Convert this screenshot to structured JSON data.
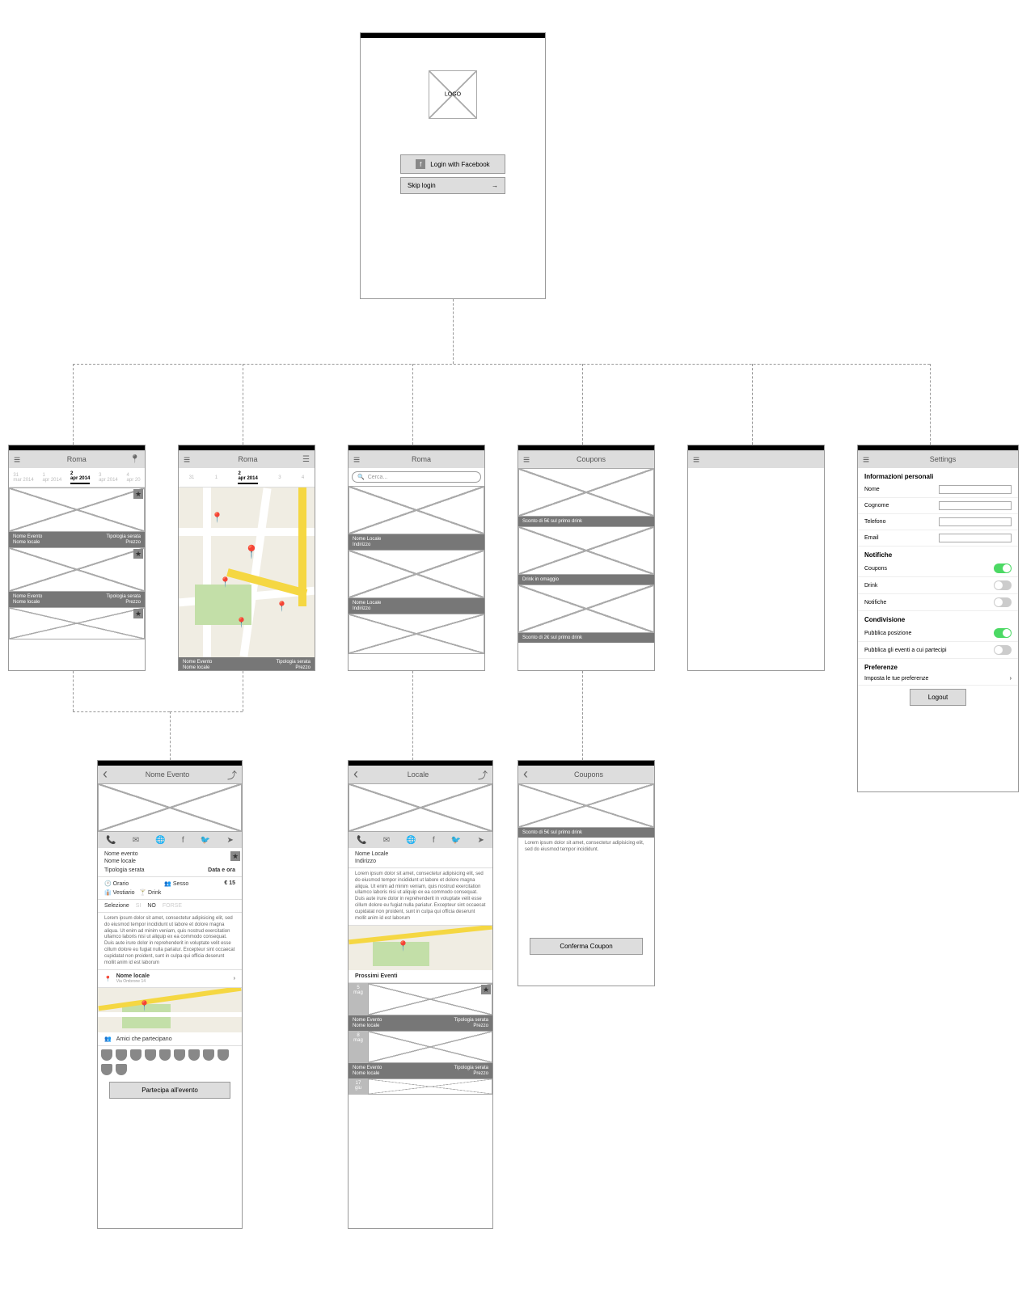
{
  "login": {
    "logo": "LOGO",
    "fb_btn": "Login with Facebook",
    "skip_btn": "Skip login"
  },
  "dates": {
    "d1": "31",
    "d1s": "mar 2014",
    "d2": "1",
    "d2s": "apr 2014",
    "d3": "2",
    "d3s": "apr 2014",
    "d4": "3",
    "d4s": "apr 2014",
    "d5": "4",
    "d5s": "apr 20"
  },
  "titles": {
    "roma": "Roma",
    "coupons": "Coupons",
    "settings": "Settings",
    "evento": "Nome Evento",
    "locale": "Locale"
  },
  "card": {
    "evento": "Nome Evento",
    "locale": "Nome locale",
    "tipo": "Tipologia serata",
    "prezzo": "Prezzo",
    "indirizzo": "Indirizzo",
    "nomelocale": "Nome Locale"
  },
  "coupons": {
    "c1": "Sconto di 5€ sul primo drink",
    "c2": "Drink in omaggio",
    "c3": "Sconto di 2€ sul primo drink"
  },
  "search": {
    "placeholder": "Cerca..."
  },
  "settings": {
    "info": "Informazioni personali",
    "nome": "Nome",
    "cognome": "Cognome",
    "tel": "Telefono",
    "email": "Email",
    "notif": "Notifiche",
    "coupons": "Coupons",
    "drink": "Drink",
    "notifiche": "Notifiche",
    "cond": "Condivisione",
    "pubpos": "Pubblica posizione",
    "pubev": "Pubblica gli eventi a cui partecipi",
    "pref": "Preferenze",
    "impref": "Imposta le tue preferenze",
    "logout": "Logout"
  },
  "event": {
    "nome": "Nome evento",
    "locale": "Nome locale",
    "tipo": "Tipologia serata",
    "dataora": "Data e ora",
    "orario": "Orario",
    "sesso": "Sesso",
    "vestiario": "Vestiario",
    "drink": "Drink",
    "prezzo": "€ 15",
    "selezione": "Selezione",
    "si": "SI",
    "no": "NO",
    "forse": "FORSE",
    "lorem": "Lorem ipsum dolor sit amet, consectetur adipisicing elit, sed do eiusmod tempor incididunt ut labore et dolore magna aliqua. Ut enim ad minim veniam, quis nostrud exercitation ullamco laboris nisi ut aliquip ex ea commodo consequat. Duis aute irure dolor in reprehenderit in voluptate velit esse cillum dolore eu fugiat nulla pariatur. Excepteur sint occaecat cupidatat non proident, sunt in culpa qui officia deserunt mollit anim id est laborum",
    "addr": "Via Ombrone 14",
    "amici": "Amici che partecipano",
    "partecipa": "Partecipa all'evento"
  },
  "locale": {
    "nome": "Nome Locale",
    "ind": "Indirizzo",
    "lorem": "Lorem ipsum dolor sit amet, consectetur adipisicing elit, sed do eiusmod tempor incididunt ut labore et dolore magna aliqua. Ut enim ad minim veniam, quis nostrud exercitation ullamco laboris nisi ut aliquip ex ea commodo consequat. Duis aute irure dolor in reprehenderit in voluptate velit esse cillum dolore eu fugiat nulla pariatur. Excepteur sint occaecat cupidatat non proident, sunt in culpa qui officia deserunt mollit anim id est laborum",
    "prossimi": "Prossimi Eventi",
    "d1": "5",
    "d1m": "mag",
    "d2": "8",
    "d2m": "mag",
    "d3": "17",
    "d3m": "giu"
  },
  "coupon_detail": {
    "title": "Sconto di 5€ sul primo drink",
    "lorem": "Lorem ipsum dolor sit amet, consectetur adipisicing elit, sed do eiusmod tempor incididunt.",
    "btn": "Conferma Coupon"
  }
}
